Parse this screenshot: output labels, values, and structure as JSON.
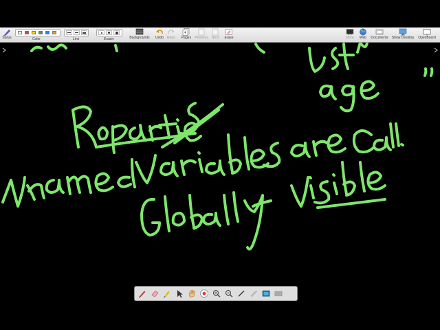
{
  "toolbar": {
    "stylus_label": "Stylus",
    "color_label": "Color",
    "line_label": "Line",
    "eraser_label": "Eraser",
    "backgrounds_label": "Backgrounds",
    "undo_label": "Undo",
    "redo_label": "Redo",
    "pages_label": "Pages",
    "previous_label": "Previous",
    "next_label": "Next",
    "erase_label": "Erase",
    "more_label": "More",
    "web_label": "Web",
    "documents_label": "Documents",
    "show_desktop_label": "Show Desktop",
    "app_label": "OpenBoard",
    "swatch_colors": [
      "#ffffff",
      "#e53935",
      "#ffd600",
      "#43a047",
      "#1e88e5",
      "#ff9800"
    ]
  },
  "board": {
    "background": "#000000",
    "ink_color": "#7ee66b"
  },
  "floating_toolbar": {
    "tools": [
      "pen-icon",
      "eraser-icon",
      "marker-icon",
      "selector-icon",
      "hand-icon",
      "laser-icon",
      "zoom-in-icon",
      "zoom-out-icon",
      "line-icon",
      "text-icon",
      "capture-icon",
      "visual-keyboard-icon"
    ]
  }
}
